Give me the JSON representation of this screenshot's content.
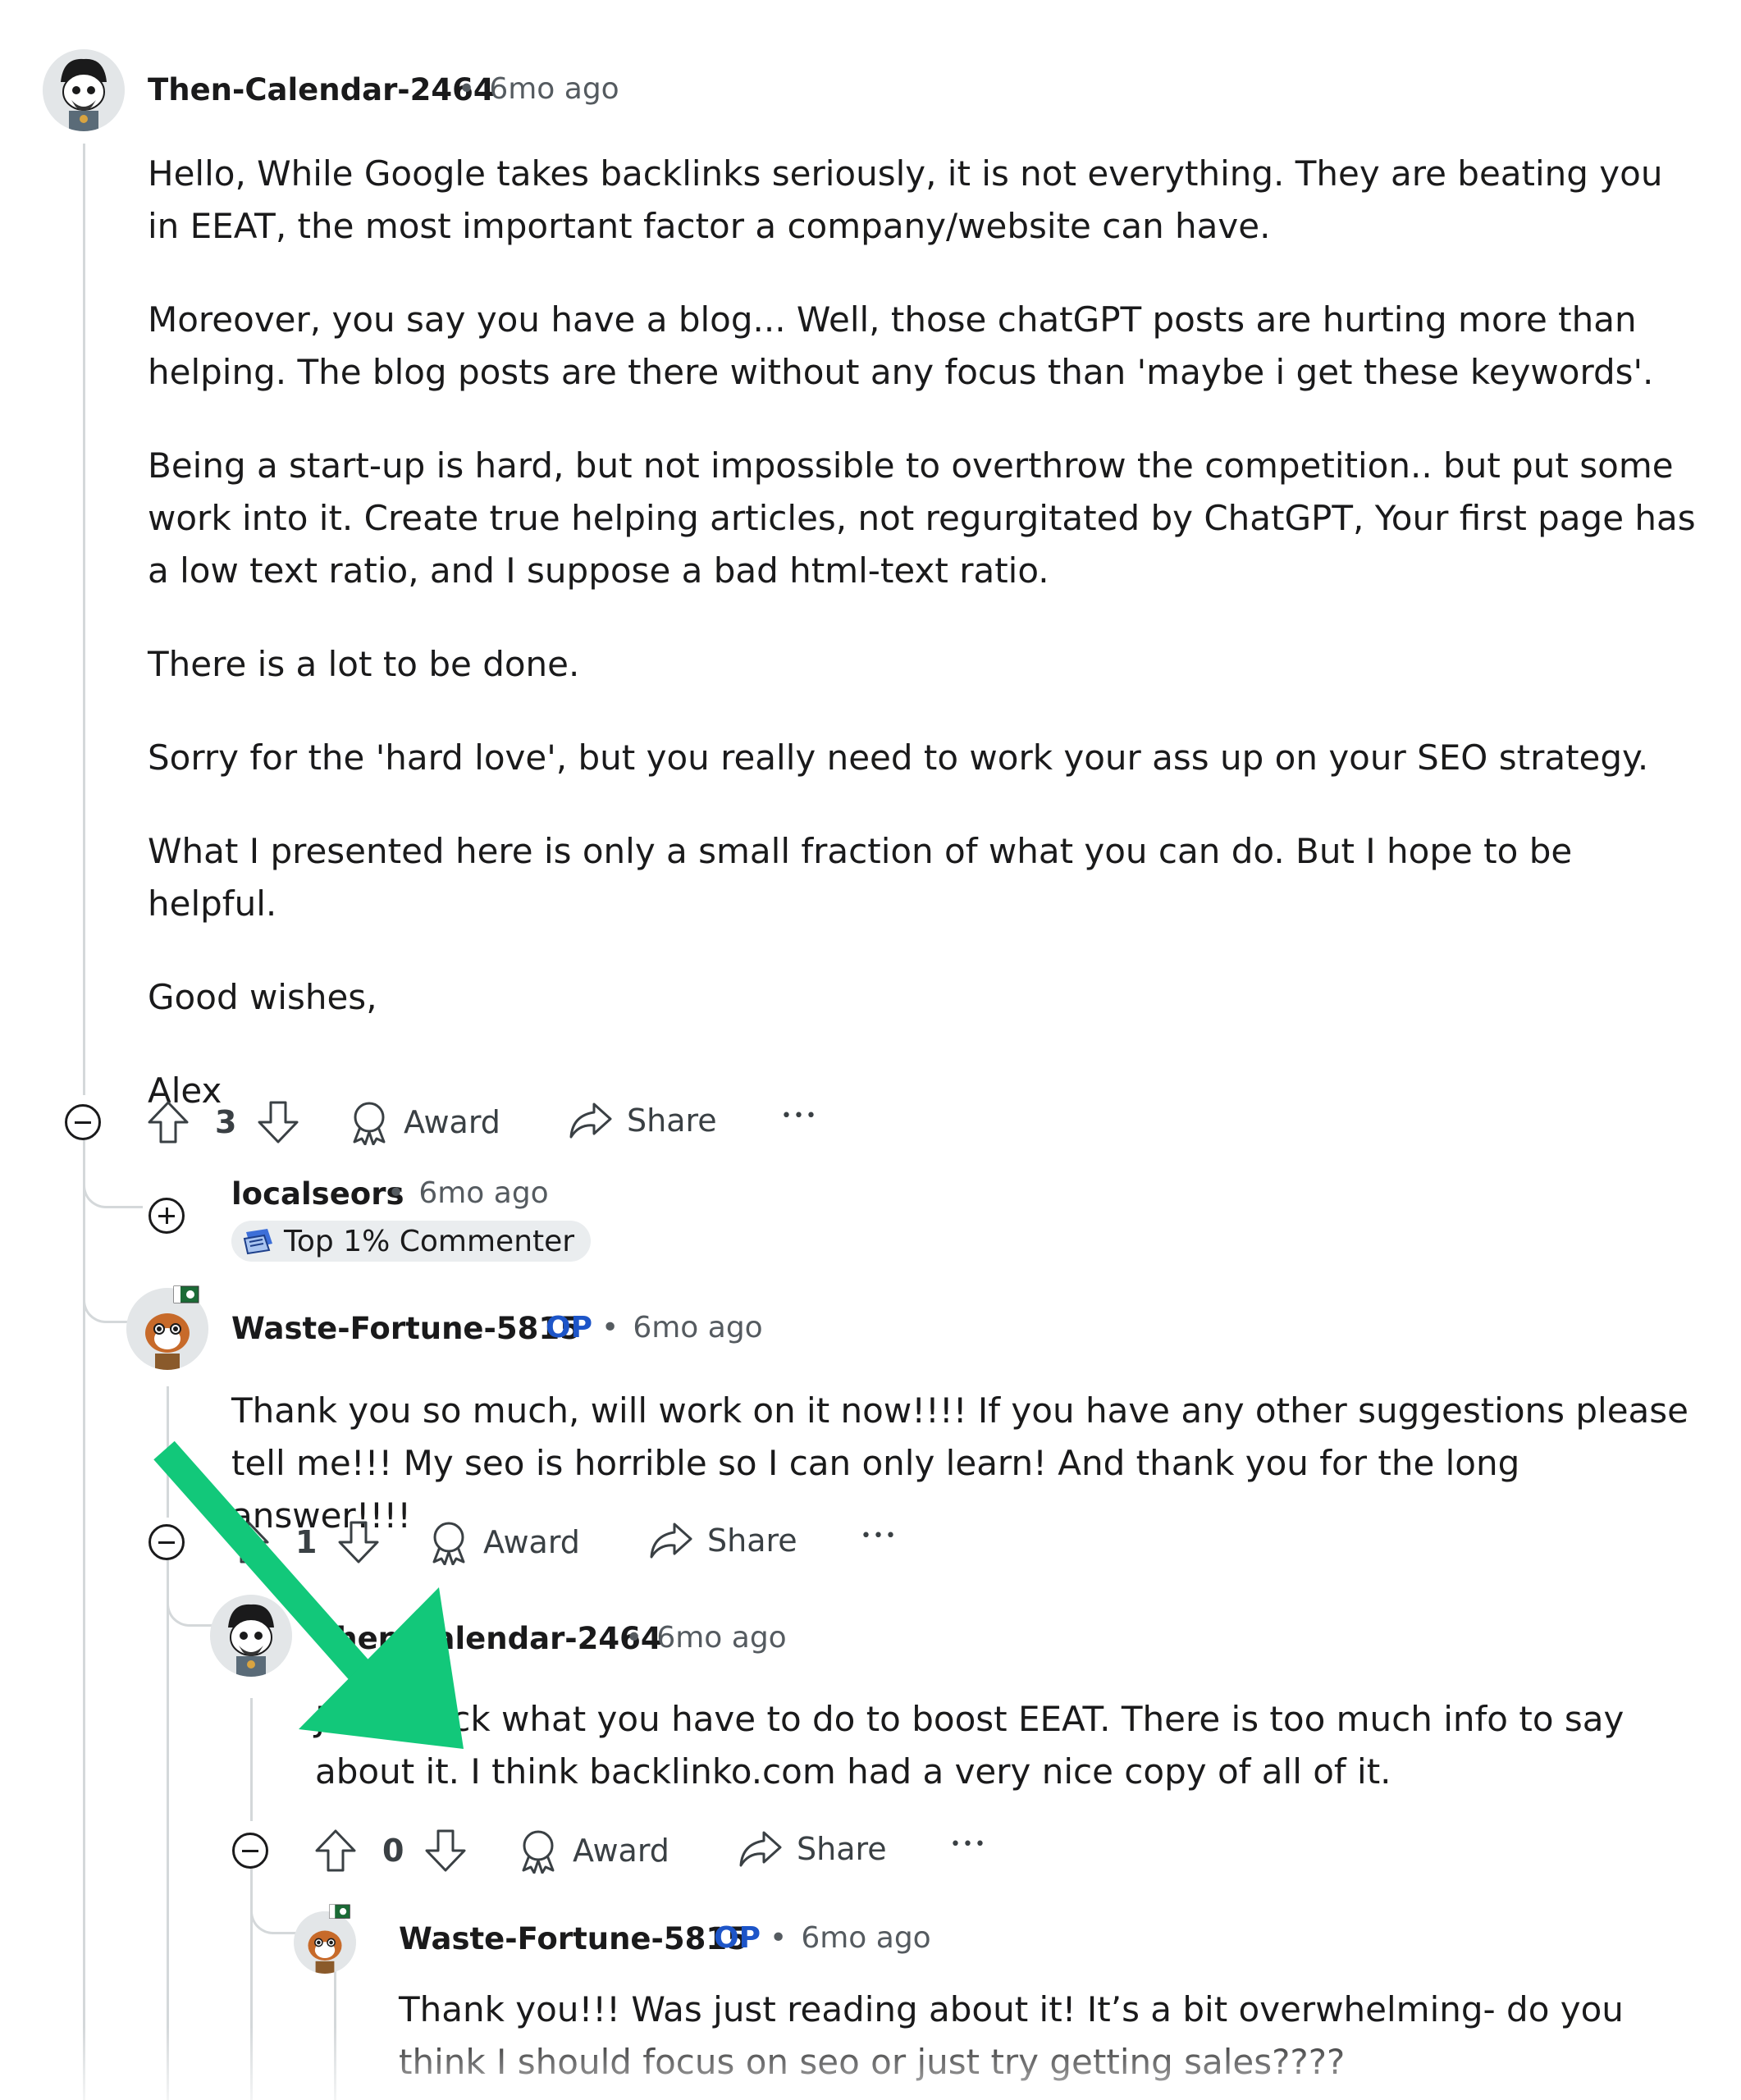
{
  "comment1": {
    "username": "Then-Calendar-2464",
    "time": "6mo ago",
    "paragraphs": [
      "Hello, While Google takes backlinks seriously, it is not everything. They are beating you in EEAT, the most important factor a company/website can have.",
      "Moreover, you say you have a blog... Well, those chatGPT posts are hurting more than helping. The blog posts are there without any focus than 'maybe i get these keywords'.",
      "Being a start-up is hard, but not impossible to overthrow the competition.. but put some work into it. Create true helping articles, not regurgitated by ChatGPT, Your first page has a low text ratio, and I suppose a bad html-text ratio.",
      "There is a lot to be done.",
      "Sorry for the 'hard love', but you really need to work your ass up on your SEO strategy.",
      "What I presented here is only a small fraction of what you can do. But I hope to be helpful.",
      "Good wishes,",
      "Alex"
    ],
    "votes": "3",
    "award_label": "Award",
    "share_label": "Share",
    "more_label": "•••"
  },
  "comment2": {
    "username": "localseors",
    "time": "6mo ago",
    "badge": "Top 1% Commenter"
  },
  "comment3": {
    "username": "Waste-Fortune-5815",
    "op": "OP",
    "time": "6mo ago",
    "text": "Thank you so much, will work on it now!!!! If you have any other suggestions please tell me!!! My seo is horrible so I can only learn! And thank you for the long answer!!!!",
    "votes": "1",
    "award_label": "Award",
    "share_label": "Share",
    "more_label": "•••"
  },
  "comment4": {
    "username": "Then-Calendar-2464",
    "time": "6mo ago",
    "text": "Just check what you have to do to boost EEAT. There is too much info to say about it. I think backlinko.com had a very nice copy of all of it.",
    "votes": "0",
    "award_label": "Award",
    "share_label": "Share",
    "more_label": "•••"
  },
  "comment5": {
    "username": "Waste-Fortune-5815",
    "op": "OP",
    "time": "6mo ago",
    "text": "Thank you!!! Was just reading about it! It’s a bit overwhelming- do you think I should focus on seo or just try getting sales????"
  },
  "separator": "•",
  "colors": {
    "arrow": "#12c87a",
    "op": "#1d55c8",
    "thread": "#d4d8da"
  },
  "icons": [
    "upvote-icon",
    "downvote-icon",
    "award-icon",
    "share-icon",
    "collapse-icon",
    "expand-icon",
    "commenter-badge-icon",
    "annotation-arrow"
  ]
}
